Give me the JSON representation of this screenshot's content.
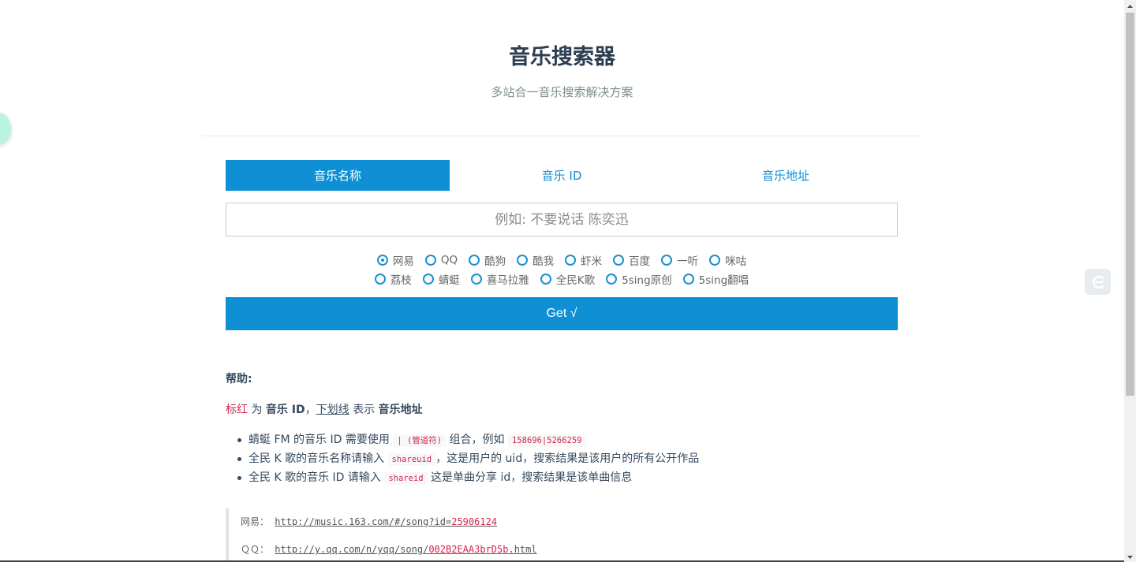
{
  "header": {
    "title": "音乐搜索器",
    "subtitle": "多站合一音乐搜索解决方案"
  },
  "tabs": [
    {
      "label": "音乐名称",
      "active": true
    },
    {
      "label": "音乐 ID",
      "active": false
    },
    {
      "label": "音乐地址",
      "active": false
    }
  ],
  "search": {
    "placeholder": "例如: 不要说话 陈奕迅",
    "value": ""
  },
  "sources_row1": [
    {
      "label": "网易",
      "checked": true
    },
    {
      "label": "QQ",
      "checked": false
    },
    {
      "label": "酷狗",
      "checked": false
    },
    {
      "label": "酷我",
      "checked": false
    },
    {
      "label": "虾米",
      "checked": false
    },
    {
      "label": "百度",
      "checked": false
    },
    {
      "label": "一听",
      "checked": false
    },
    {
      "label": "咪咕",
      "checked": false
    }
  ],
  "sources_row2": [
    {
      "label": "荔枝",
      "checked": false
    },
    {
      "label": "蜻蜓",
      "checked": false
    },
    {
      "label": "喜马拉雅",
      "checked": false
    },
    {
      "label": "全民K歌",
      "checked": false
    },
    {
      "label": "5sing原创",
      "checked": false
    },
    {
      "label": "5sing翻唱",
      "checked": false
    }
  ],
  "get_button": "Get √",
  "help": {
    "title": "帮助:",
    "legend": {
      "red_word": "标红",
      "t1": " 为 ",
      "id_word": "音乐 ID",
      "t2": "，",
      "underline_word": "下划线",
      "t3": " 表示 ",
      "url_word": "音乐地址"
    },
    "notes": [
      {
        "pre": "蜻蜓 FM 的音乐 ID 需要使用 ",
        "code": "| (管道符)",
        "post": " 组合，例如 ",
        "code2": "158696|5266259"
      },
      {
        "pre": "全民 K 歌的音乐名称请输入 ",
        "code": "shareuid",
        "post": "，这是用户的 uid，搜索结果是该用户的所有公开作品",
        "code2": ""
      },
      {
        "pre": "全民 K 歌的音乐 ID 请输入 ",
        "code": "shareid",
        "post": " 这是单曲分享 id，搜索结果是该单曲信息",
        "code2": ""
      }
    ]
  },
  "examples": [
    {
      "label": "网易：",
      "url_prefix": "http://music.163.com/#/song?id=",
      "url_id": "25906124"
    },
    {
      "label": "ＱＱ：",
      "url_prefix": "http://y.qq.com/n/yqq/song/",
      "url_id": "002B2EAA3brD5b",
      "url_suffix": ".html"
    }
  ],
  "colors": {
    "accent": "#1090d4",
    "highlight": "#d4254f",
    "text": "#34495e"
  },
  "icons": {
    "side_button": "translate-logo-icon",
    "floating_bubble": "assistant-bubble-icon"
  }
}
